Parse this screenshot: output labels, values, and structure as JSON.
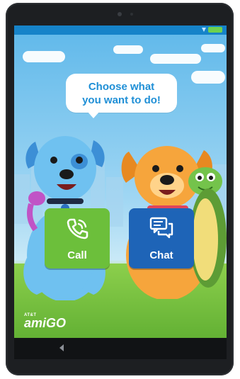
{
  "app": {
    "headline_line1": "Choose what",
    "headline_line2": "you want to do!",
    "buttons": {
      "call": {
        "label": "Call",
        "icon": "phone-icon",
        "color": "#6cbf3b"
      },
      "chat": {
        "label": "Chat",
        "icon": "chat-bubbles-icon",
        "color": "#1e64b7"
      }
    },
    "logo": {
      "brand": "AT&T",
      "product": "amiGO"
    }
  },
  "device": {
    "status_bar": {
      "icons": [
        "wifi-icon",
        "battery-icon"
      ],
      "color": "#1683c9"
    },
    "nav_bar": {
      "icons": [
        "back-icon"
      ]
    }
  },
  "theme": {
    "sky": "#5fb8ea",
    "grass": "#7fc54a",
    "headline_color": "#1f8fd6"
  }
}
